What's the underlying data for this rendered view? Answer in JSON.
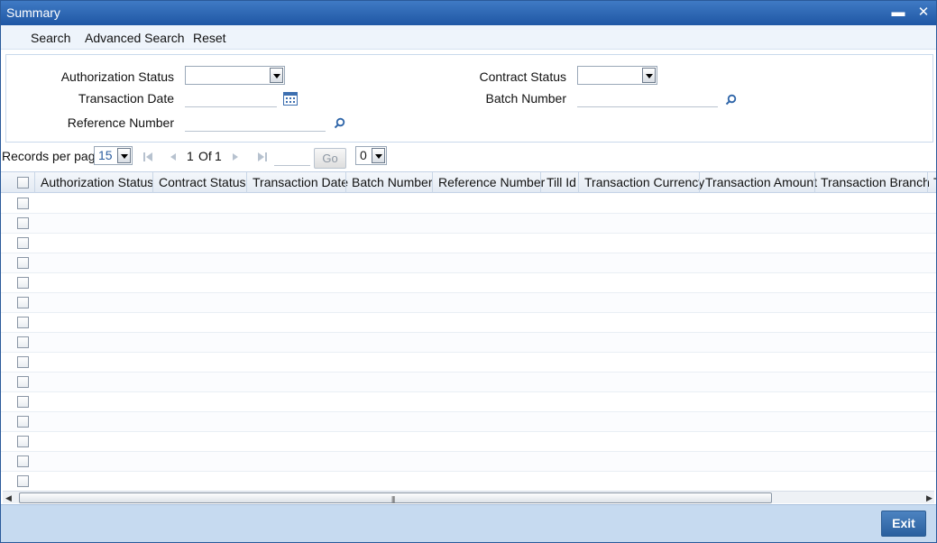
{
  "window": {
    "title": "Summary",
    "minimize_glyph": "▬",
    "close_glyph": "✕"
  },
  "toolbar": {
    "search_label": "Search",
    "advanced_search_label": "Advanced Search",
    "reset_label": "Reset"
  },
  "criteria": {
    "authorization_status": {
      "label": "Authorization Status",
      "value": ""
    },
    "contract_status": {
      "label": "Contract Status",
      "value": ""
    },
    "transaction_date": {
      "label": "Transaction Date",
      "value": ""
    },
    "batch_number": {
      "label": "Batch Number",
      "value": ""
    },
    "reference_number": {
      "label": "Reference Number",
      "value": ""
    }
  },
  "pager": {
    "records_per_page_label": "Records per page",
    "records_per_page_value": "15",
    "current_page": "1",
    "of_label": "Of",
    "total_pages": "1",
    "goto_value": "",
    "go_label": "Go",
    "jump_select_value": "0"
  },
  "grid": {
    "columns": [
      "Authorization Status",
      "Contract Status",
      "Transaction Date",
      "Batch Number",
      "Reference Number",
      "Till Id",
      "Transaction Currency",
      "Transaction Amount",
      "Transaction Branch",
      "T"
    ],
    "empty_row_count": 15
  },
  "footer": {
    "exit_label": "Exit"
  },
  "colors": {
    "titlebar": "#1f57a4",
    "footer": "#c6daf0",
    "exit_button": "#2a5f9e"
  }
}
